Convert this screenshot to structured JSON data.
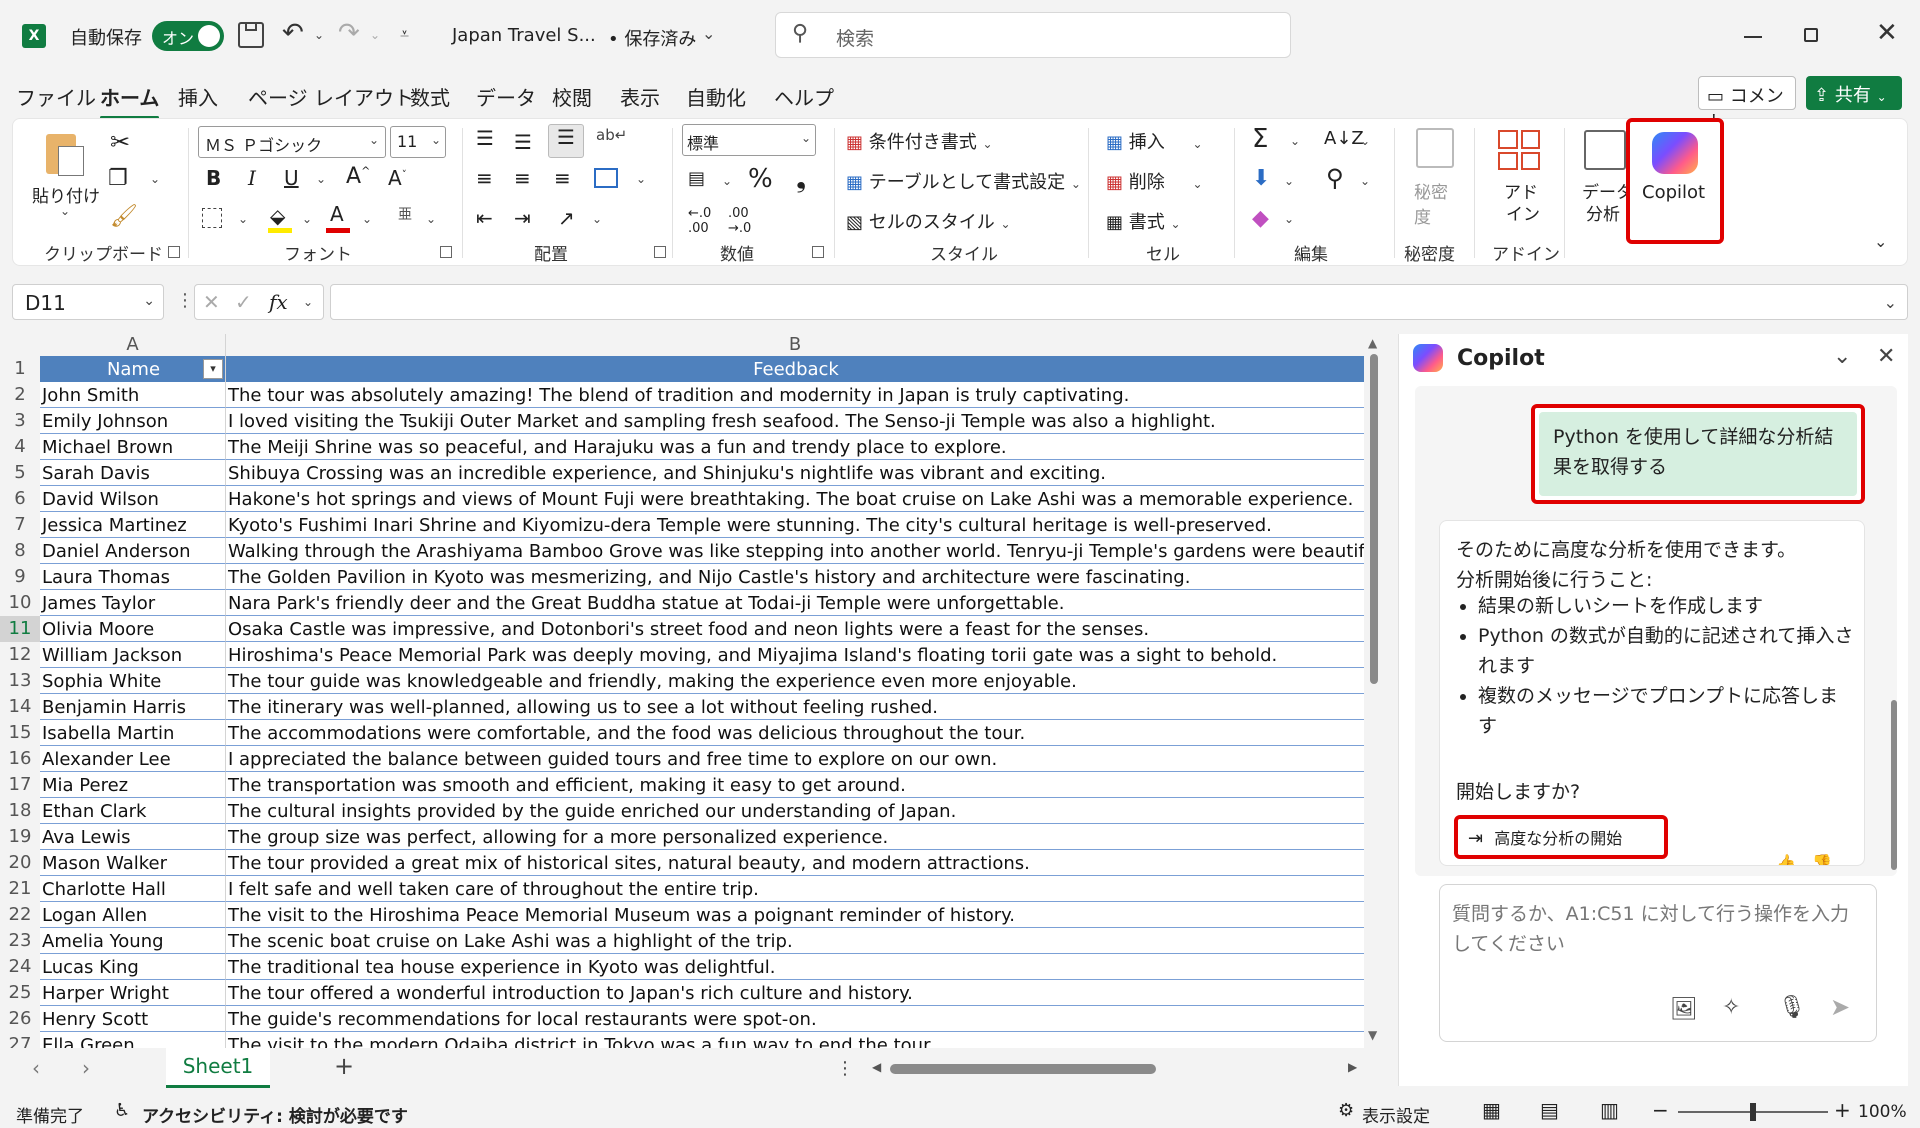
{
  "titlebar": {
    "autosave_label": "自動保存",
    "autosave_state": "オン",
    "file_name": "Japan Travel S...",
    "save_status": "• 保存済み",
    "search_placeholder": "検索"
  },
  "menu_tabs": [
    "ファイル",
    "ホーム",
    "挿入",
    "ページ レイアウト",
    "数式",
    "データ",
    "校閲",
    "表示",
    "自動化",
    "ヘルプ"
  ],
  "menu_active": "ホーム",
  "comment_button": "コメント",
  "share_button": "共有",
  "ribbon": {
    "clipboard": {
      "paste": "貼り付け",
      "label": "クリップボード"
    },
    "font": {
      "name": "ＭＳ Ｐゴシック",
      "size": "11",
      "label": "フォント",
      "bold": "B",
      "italic": "I",
      "underline": "U"
    },
    "alignment": {
      "label": "配置"
    },
    "number": {
      "format": "標準",
      "percent": "%",
      "label": "数値"
    },
    "style": {
      "conditional": "条件付き書式",
      "table": "テーブルとして書式設定",
      "cell_style": "セルのスタイル",
      "label": "スタイル"
    },
    "cells": {
      "insert": "挿入",
      "delete": "削除",
      "format": "書式",
      "label": "セル"
    },
    "editing": {
      "label": "編集"
    },
    "sensitivity": {
      "btn": "秘密度",
      "label": "秘密度"
    },
    "addin": {
      "btn1": "アド",
      "btn2": "イン",
      "label": "アドイン"
    },
    "data_analysis": {
      "btn1": "データ",
      "btn2": "分析"
    },
    "copilot": {
      "btn": "Copilot"
    }
  },
  "formula_bar": {
    "name_box": "D11",
    "fx": "fx"
  },
  "grid": {
    "columns": [
      "A",
      "B"
    ],
    "header": {
      "name": "Name",
      "feedback": "Feedback"
    },
    "rows": [
      {
        "num": "2",
        "name": "John Smith",
        "feedback": "The tour was absolutely amazing! The blend of tradition and modernity in Japan is truly captivating."
      },
      {
        "num": "3",
        "name": "Emily Johnson",
        "feedback": "I loved visiting the Tsukiji Outer Market and sampling fresh seafood. The Senso-ji Temple was also a highlight."
      },
      {
        "num": "4",
        "name": "Michael Brown",
        "feedback": "The Meiji Shrine was so peaceful, and Harajuku was a fun and trendy place to explore."
      },
      {
        "num": "5",
        "name": "Sarah Davis",
        "feedback": "Shibuya Crossing was an incredible experience, and Shinjuku's nightlife was vibrant and exciting."
      },
      {
        "num": "6",
        "name": "David Wilson",
        "feedback": "Hakone's hot springs and views of Mount Fuji were breathtaking. The boat cruise on Lake Ashi was a memorable experience."
      },
      {
        "num": "7",
        "name": "Jessica Martinez",
        "feedback": "Kyoto's Fushimi Inari Shrine and Kiyomizu-dera Temple were stunning. The city's cultural heritage is well-preserved."
      },
      {
        "num": "8",
        "name": "Daniel Anderson",
        "feedback": "Walking through the Arashiyama Bamboo Grove was like stepping into another world. Tenryu-ji Temple's gardens were beautiful."
      },
      {
        "num": "9",
        "name": "Laura Thomas",
        "feedback": "The Golden Pavilion in Kyoto was mesmerizing, and Nijo Castle's history and architecture were fascinating."
      },
      {
        "num": "10",
        "name": "James Taylor",
        "feedback": "Nara Park's friendly deer and the Great Buddha statue at Todai-ji Temple were unforgettable."
      },
      {
        "num": "11",
        "name": "Olivia Moore",
        "feedback": "Osaka Castle was impressive, and Dotonbori's street food and neon lights were a feast for the senses."
      },
      {
        "num": "12",
        "name": "William Jackson",
        "feedback": "Hiroshima's Peace Memorial Park was deeply moving, and Miyajima Island's floating torii gate was a sight to behold."
      },
      {
        "num": "13",
        "name": "Sophia White",
        "feedback": "The tour guide was knowledgeable and friendly, making the experience even more enjoyable."
      },
      {
        "num": "14",
        "name": "Benjamin Harris",
        "feedback": "The itinerary was well-planned, allowing us to see a lot without feeling rushed."
      },
      {
        "num": "15",
        "name": "Isabella Martin",
        "feedback": "The accommodations were comfortable, and the food was delicious throughout the tour."
      },
      {
        "num": "16",
        "name": "Alexander Lee",
        "feedback": "I appreciated the balance between guided tours and free time to explore on our own."
      },
      {
        "num": "17",
        "name": "Mia Perez",
        "feedback": "The transportation was smooth and efficient, making it easy to get around."
      },
      {
        "num": "18",
        "name": "Ethan Clark",
        "feedback": "The cultural insights provided by the guide enriched our understanding of Japan."
      },
      {
        "num": "19",
        "name": "Ava Lewis",
        "feedback": "The group size was perfect, allowing for a more personalized experience."
      },
      {
        "num": "20",
        "name": "Mason Walker",
        "feedback": "The tour provided a great mix of historical sites, natural beauty, and modern attractions."
      },
      {
        "num": "21",
        "name": "Charlotte Hall",
        "feedback": "I felt safe and well taken care of throughout the entire trip."
      },
      {
        "num": "22",
        "name": "Logan Allen",
        "feedback": "The visit to the Hiroshima Peace Memorial Museum was a poignant reminder of history."
      },
      {
        "num": "23",
        "name": "Amelia Young",
        "feedback": "The scenic boat cruise on Lake Ashi was a highlight of the trip."
      },
      {
        "num": "24",
        "name": "Lucas King",
        "feedback": "The traditional tea house experience in Kyoto was delightful."
      },
      {
        "num": "25",
        "name": "Harper Wright",
        "feedback": "The tour offered a wonderful introduction to Japan's rich culture and history."
      },
      {
        "num": "26",
        "name": "Henry Scott",
        "feedback": "The guide's recommendations for local restaurants were spot-on."
      },
      {
        "num": "27",
        "name": "Ella Green",
        "feedback": "The visit to the modern Odaiba district in Tokyo was a fun way to end the tour."
      }
    ]
  },
  "sheet_tabs": {
    "active": "Sheet1",
    "add": "+"
  },
  "copilot_pane": {
    "title": "Copilot",
    "user_message": "Python を使用して詳細な分析結果を取得する",
    "reply_intro": "そのために高度な分析を使用できます。",
    "reply_sub": "分析開始後に行うこと:",
    "reply_bullets": [
      "結果の新しいシートを作成します",
      "Python の数式が自動的に記述されて挿入されます",
      "複数のメッセージでプロンプトに応答します"
    ],
    "reply_question": "開始しますか?",
    "start_button": "高度な分析の開始",
    "input_placeholder": "質問するか、A1:C51 に対して行う操作を入力してください"
  },
  "statusbar": {
    "ready": "準備完了",
    "accessibility": "アクセシビリティ: 検討が必要です",
    "display_settings": "表示設定",
    "zoom": "100%"
  },
  "colors": {
    "excel_green": "#107c41",
    "header_blue": "#4f81bd",
    "highlight_red": "#e00000",
    "user_bubble": "#d6efe0"
  }
}
